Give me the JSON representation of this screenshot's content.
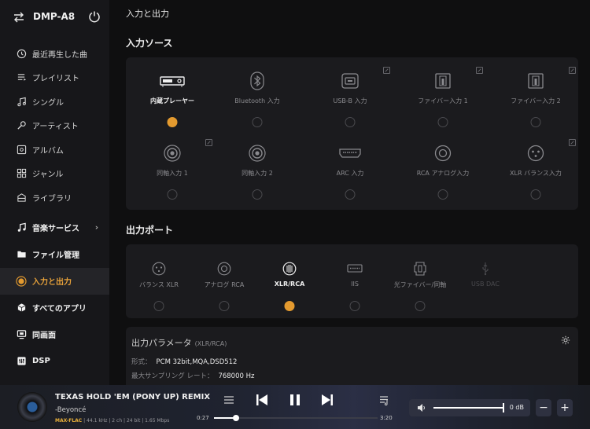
{
  "colors": {
    "accent": "#e39a2f",
    "bg": "#0f0f10",
    "panel": "#1b1b1e",
    "sidebar": "#17171a"
  },
  "device": {
    "name": "DMP-A8"
  },
  "sidebar": {
    "items": [
      {
        "label": "最近再生した曲",
        "icon": "clock-icon"
      },
      {
        "label": "プレイリスト",
        "icon": "playlist-icon"
      },
      {
        "label": "シングル",
        "icon": "music-note-icon"
      },
      {
        "label": "アーティスト",
        "icon": "microphone-icon"
      },
      {
        "label": "アルバム",
        "icon": "album-icon"
      },
      {
        "label": "ジャンル",
        "icon": "grid-icon"
      },
      {
        "label": "ライブラリ",
        "icon": "library-icon"
      }
    ],
    "sections": [
      {
        "label": "音楽サービス",
        "icon": "music-service-icon",
        "chevron": "›"
      },
      {
        "label": "ファイル管理",
        "icon": "folder-icon"
      },
      {
        "label": "入力と出力",
        "icon": "radio-dot-icon",
        "active": true
      },
      {
        "label": "すべてのアプリ",
        "icon": "cube-icon"
      },
      {
        "label": "同画面",
        "icon": "mirror-icon"
      },
      {
        "label": "DSP",
        "icon": "dsp-icon"
      }
    ]
  },
  "main": {
    "page_title": "入力と出力",
    "input_title": "入力ソース",
    "inputs": [
      {
        "label": "内蔵プレーヤー",
        "icon": "player-icon",
        "selected": true,
        "editable": false
      },
      {
        "label": "Bluetooth 入力",
        "icon": "bluetooth-icon",
        "selected": false,
        "editable": false
      },
      {
        "label": "USB-B 入力",
        "icon": "usb-b-icon",
        "selected": false,
        "editable": true
      },
      {
        "label": "ファイバー入力 1",
        "icon": "optical-icon",
        "selected": false,
        "editable": true
      },
      {
        "label": "ファイバー入力 2",
        "icon": "optical-icon",
        "selected": false,
        "editable": true
      },
      {
        "label": "同軸入力 1",
        "icon": "coax-icon",
        "selected": false,
        "editable": true
      },
      {
        "label": "同軸入力 2",
        "icon": "coax-icon",
        "selected": false,
        "editable": false
      },
      {
        "label": "ARC 入力",
        "icon": "hdmi-icon",
        "selected": false,
        "editable": false
      },
      {
        "label": "RCA アナログ入力",
        "icon": "rca-icon",
        "selected": false,
        "editable": false
      },
      {
        "label": "XLR バランス入力",
        "icon": "xlr-icon",
        "selected": false,
        "editable": true
      }
    ],
    "output_title": "出力ポート",
    "outputs": [
      {
        "label": "バランス XLR",
        "icon": "xlr-icon",
        "selected": false,
        "disabled": false
      },
      {
        "label": "アナログ RCA",
        "icon": "rca-icon",
        "selected": false,
        "disabled": false
      },
      {
        "label": "XLR/RCA",
        "icon": "xlr-rca-icon",
        "selected": true,
        "disabled": false
      },
      {
        "label": "IIS",
        "icon": "iis-icon",
        "selected": false,
        "disabled": false
      },
      {
        "label": "光ファイバー/同軸",
        "icon": "optical-icon",
        "selected": false,
        "disabled": false
      },
      {
        "label": "USB DAC",
        "icon": "usb-icon",
        "selected": false,
        "disabled": true
      }
    ],
    "params": {
      "title": "出力パラメータ",
      "subtitle": "(XLR/RCA)",
      "format_label": "形式：",
      "format_value": "PCM 32bit,MQA,DSD512",
      "rate_label": "最大サンプリング レート：",
      "rate_value": "768000 Hz"
    }
  },
  "player": {
    "title": "TEXAS HOLD 'EM (PONY UP) REMIX",
    "artist": "-Beyoncé",
    "format": "MAX-FLAC",
    "info": " | 44.1 kHz | 2 ch | 24 bit | 1.65 Mbps",
    "elapsed": "0:27",
    "duration": "3:20",
    "progress": 0.135,
    "volume_label": "0 dB",
    "volume": 1.0,
    "minus": "−",
    "plus": "+"
  }
}
